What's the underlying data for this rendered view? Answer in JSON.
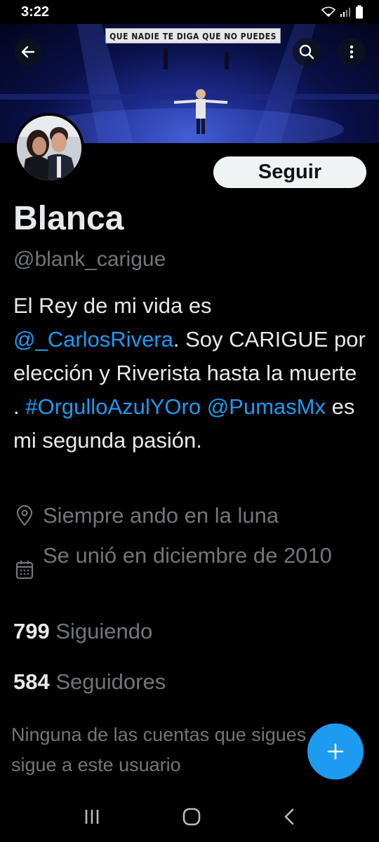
{
  "status_bar": {
    "time": "3:22"
  },
  "banner": {
    "sign_text": "QUE NADIE TE DIGA QUE NO PUEDES"
  },
  "header": {
    "back_icon": "arrow-left-icon",
    "search_icon": "search-icon",
    "more_icon": "more-vertical-icon"
  },
  "profile": {
    "follow_label": "Seguir",
    "name": "Blanca",
    "handle": "@blank_carigue",
    "bio": {
      "part1": "El Rey de mi vida es ",
      "mention1": "@_CarlosRivera",
      "part2": ". Soy CARIGUE por elección y Riverista hasta la muerte . ",
      "hashtag": "#OrgulloAzulYOro",
      "part3": " ",
      "mention2": "@PumasMx",
      "part4": " es mi segunda pasión."
    },
    "location": "Siempre ando en la luna",
    "joined": "Se unió en diciembre de 2010",
    "following_count": "799",
    "following_label": "Siguiendo",
    "followers_count": "584",
    "followers_label": "Seguidores",
    "followers_note": "Ninguna de las cuentas que sigues sigue a este usuario"
  },
  "colors": {
    "accent": "#1d9bf0",
    "background": "#000000",
    "secondary_text": "#71767b"
  }
}
